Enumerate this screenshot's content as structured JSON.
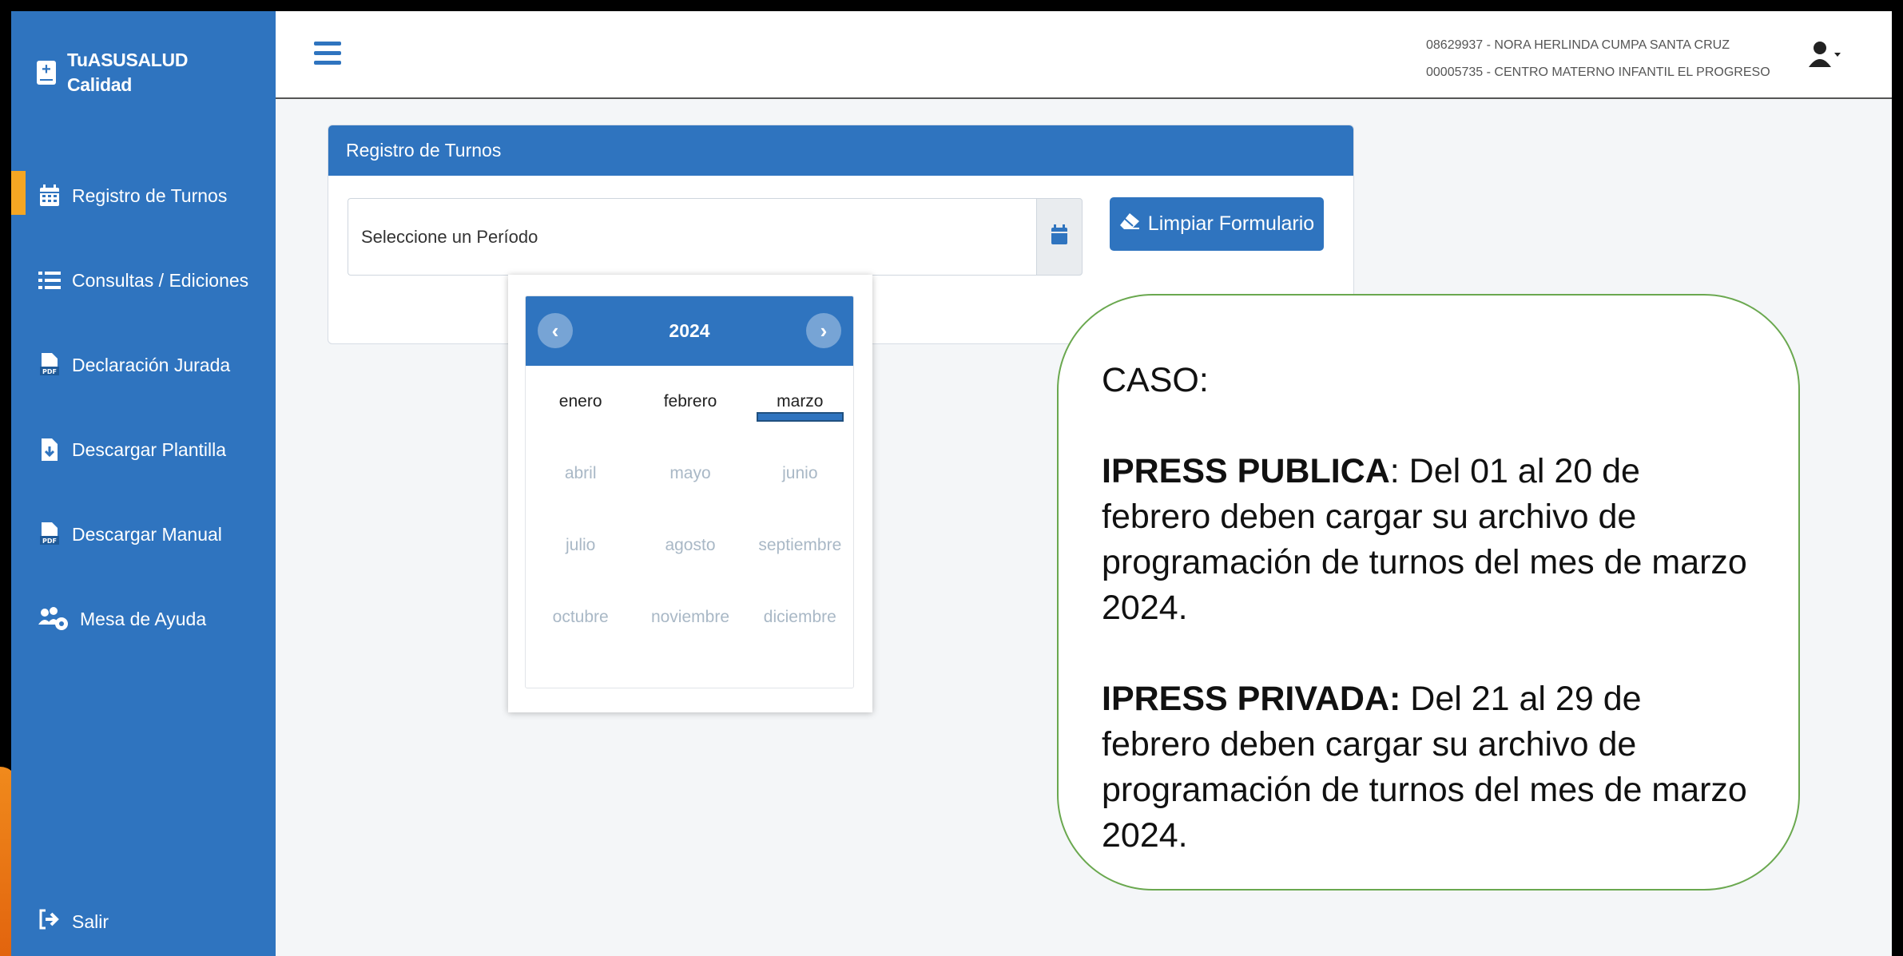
{
  "colors": {
    "sidebar": "#2f74bf",
    "accent": "#f5a623",
    "primary": "#2f74bf",
    "callout_border": "#6aa84f"
  },
  "sidebar": {
    "brand_line1": "TuASUSALUD",
    "brand_line2": "Calidad",
    "brand_icon": "medical-book-icon",
    "items": [
      {
        "label": "Registro de Turnos",
        "icon": "calendar-icon",
        "active": true
      },
      {
        "label": "Consultas / Ediciones",
        "icon": "list-icon",
        "active": false
      },
      {
        "label": "Declaración Jurada",
        "icon": "pdf-file-icon",
        "active": false
      },
      {
        "label": "Descargar Plantilla",
        "icon": "file-download-icon",
        "active": false
      },
      {
        "label": "Descargar Manual",
        "icon": "pdf-file-icon",
        "active": false
      },
      {
        "label": "Mesa de Ayuda",
        "icon": "users-gear-icon",
        "active": false
      }
    ],
    "logout_label": "Salir",
    "logout_icon": "sign-out-icon"
  },
  "topbar": {
    "menu_icon": "hamburger-icon",
    "user_line1": "08629937 - NORA HERLINDA CUMPA SANTA CRUZ",
    "user_line2": "00005735 - CENTRO MATERNO INFANTIL EL PROGRESO",
    "user_icon": "user-dropdown-icon"
  },
  "card": {
    "title": "Registro de Turnos",
    "period_placeholder": "Seleccione un Período",
    "calendar_icon": "calendar-icon",
    "clear_label": "Limpiar Formulario",
    "clear_icon": "eraser-icon"
  },
  "picker": {
    "year": "2024",
    "prev_label": "‹",
    "next_label": "›",
    "months": [
      [
        "enero",
        "febrero",
        "marzo"
      ],
      [
        "abril",
        "mayo",
        "junio"
      ],
      [
        "julio",
        "agosto",
        "septiembre"
      ],
      [
        "octubre",
        "noviembre",
        "diciembre"
      ]
    ],
    "enabled_months": [
      "enero",
      "febrero",
      "marzo"
    ],
    "selected_month": "marzo"
  },
  "callout": {
    "heading": "CASO:",
    "publica_label": "IPRESS PUBLICA",
    "publica_text": ": Del 01 al 20 de febrero deben cargar su archivo de programación de turnos del mes de marzo 2024.",
    "privada_label": "IPRESS PRIVADA:",
    "privada_text": " Del 21 al 29 de febrero deben cargar su archivo de programación de turnos del mes de marzo 2024."
  }
}
